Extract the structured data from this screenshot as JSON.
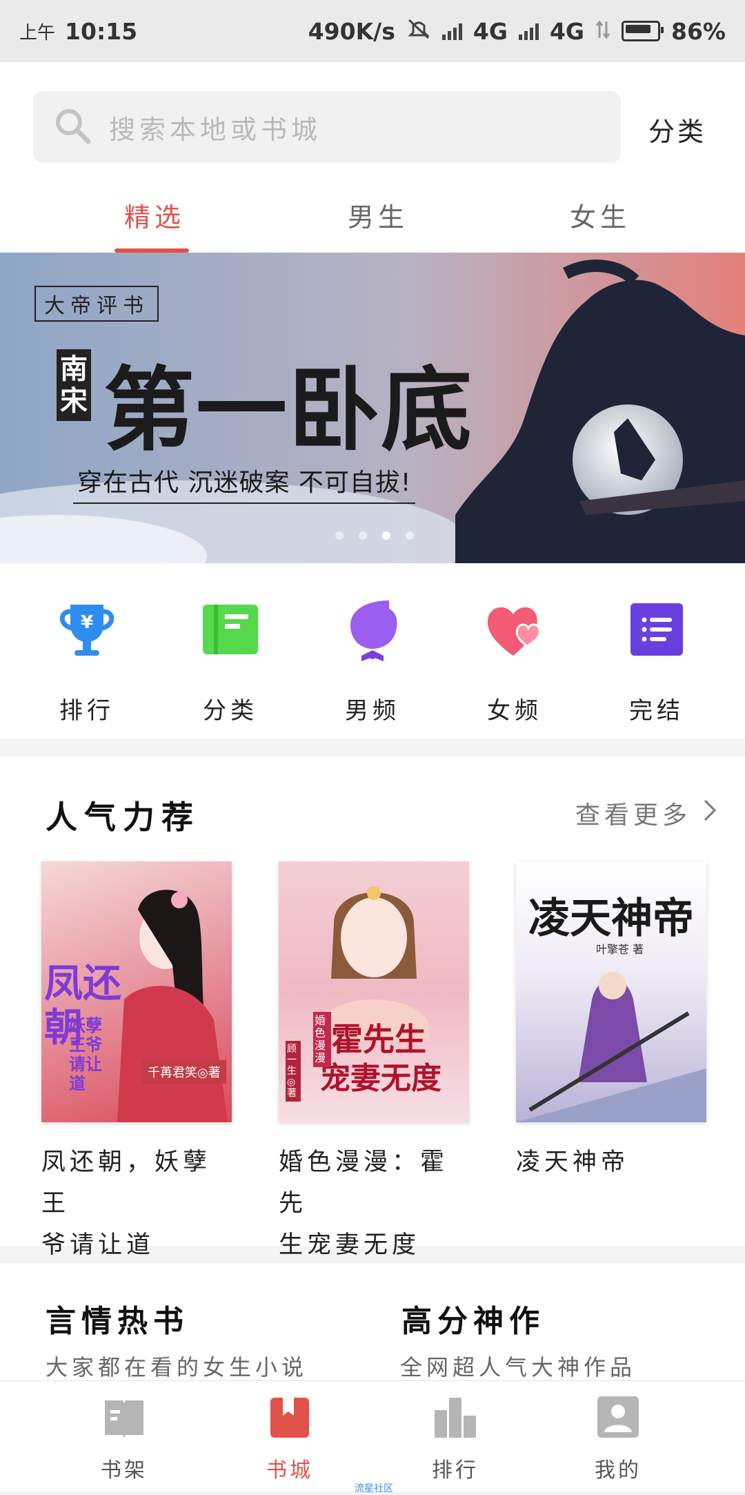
{
  "status_bar": {
    "time_prefix": "上午",
    "time": "10:15",
    "net_speed": "490K/s",
    "network_1": "4G",
    "network_2": "4G",
    "battery": "86%"
  },
  "search": {
    "placeholder": "搜索本地或书城"
  },
  "header": {
    "category_button": "分类"
  },
  "tabs": [
    {
      "label": "精选",
      "active": true
    },
    {
      "label": "男生",
      "active": false
    },
    {
      "label": "女生",
      "active": false
    }
  ],
  "banner": {
    "tag": "大帝评书",
    "side_title": "南宋",
    "main_title": "第一卧底",
    "slogan": "穿在古代 沉迷破案 不可自拔!",
    "page_count": 4,
    "active_page": 3
  },
  "quick_links": [
    {
      "label": "排行",
      "icon": "trophy-icon",
      "color": "#2f8df0"
    },
    {
      "label": "分类",
      "icon": "category-book-icon",
      "color": "#55d84b"
    },
    {
      "label": "男频",
      "icon": "boy-icon",
      "color": "#9a5ef0"
    },
    {
      "label": "女频",
      "icon": "hearts-icon",
      "color": "#f25b76"
    },
    {
      "label": "完结",
      "icon": "list-icon",
      "color": "#6a3fe0"
    }
  ],
  "popular": {
    "title": "人气力荐",
    "more": "查看更多",
    "books": [
      {
        "title_line1": "凤还朝，妖孽王",
        "title_line2": "爷请让道",
        "cover_title": "凤还朝",
        "cover_sub": "妖孽王爷请让道",
        "cover_author": "千苒君笑◎著"
      },
      {
        "title_line1": "婚色漫漫：霍先",
        "title_line2": "生宠妻无度",
        "cover_title": "霍先生",
        "cover_sub": "宠妻无度",
        "cover_badge": "婚色漫漫",
        "cover_author": "顾一生◎著"
      },
      {
        "title_line1": "凌天神帝",
        "title_line2": "",
        "cover_title": "凌天神帝",
        "cover_author": "叶擎苍 著"
      }
    ]
  },
  "sections": [
    {
      "title": "言情热书",
      "subtitle": "大家都在看的女生小说"
    },
    {
      "title": "高分神作",
      "subtitle": "全网超人气大神作品"
    }
  ],
  "bottom_nav": [
    {
      "label": "书架",
      "icon": "bookshelf-icon",
      "active": false
    },
    {
      "label": "书城",
      "icon": "bookstore-icon",
      "active": true
    },
    {
      "label": "排行",
      "icon": "ranking-icon",
      "active": false
    },
    {
      "label": "我的",
      "icon": "profile-icon",
      "active": false
    }
  ],
  "community_label": "流星社区",
  "colors": {
    "accent": "#e0524a",
    "tab_inactive": "#666666"
  }
}
